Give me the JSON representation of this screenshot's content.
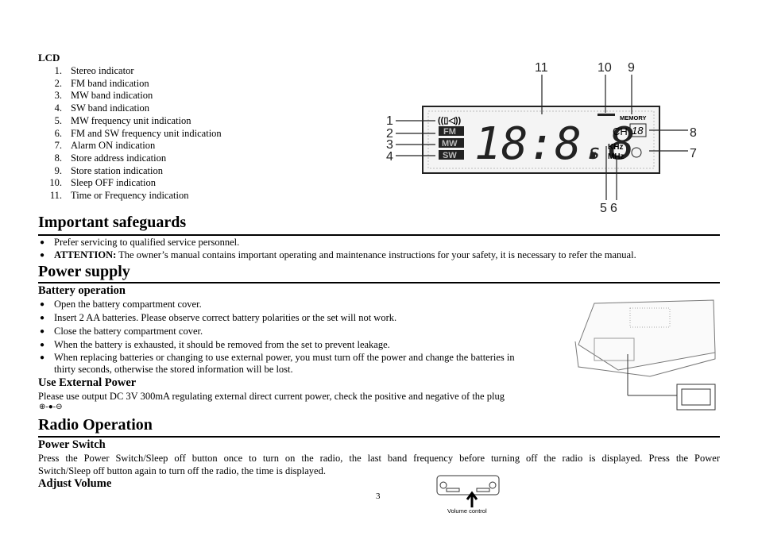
{
  "lcd": {
    "title": "LCD",
    "items": [
      "Stereo indicator",
      "FM band indication",
      "MW band indication",
      "SW band indication",
      "MW frequency unit indication",
      "FM and SW frequency unit indication",
      "Alarm ON indication",
      "Store address indication",
      "Store station indication",
      "Sleep OFF indication",
      "Time or Frequency indication"
    ],
    "diagram": {
      "callouts": [
        "1",
        "2",
        "3",
        "4",
        "5",
        "6",
        "7",
        "8",
        "9",
        "10",
        "11"
      ],
      "bands": [
        "FM",
        "MW",
        "SW"
      ],
      "digits": "18:8.8",
      "memory": "MEMORY",
      "ch": "CH",
      "ch_value": "18",
      "khz": "KHz",
      "mhz": "MHz"
    }
  },
  "safeguards": {
    "title": "Important safeguards",
    "bullets": [
      {
        "lead": "",
        "text": "Prefer servicing to qualified service personnel."
      },
      {
        "lead": "ATTENTION:",
        "text": " The owner’s manual contains important operating and maintenance instructions for your safety, it is necessary to refer the manual."
      }
    ]
  },
  "power": {
    "title": "Power supply",
    "battery_title": "Battery operation",
    "bullets": [
      "Open the battery compartment cover.",
      "Insert 2 AA batteries. Please observe correct battery polarities or the set will not work.",
      "Close the battery compartment cover.",
      "When the battery is exhausted, it should be removed from the set to prevent leakage.",
      "When replacing batteries or changing to use external power, you must turn off the power and change the batteries in",
      "thirty seconds, otherwise the stored information will be lost."
    ],
    "external_title": "Use External Power",
    "external_text": "Please use output DC 3V 300mA regulating external direct current power, check the positive and negative of the plug",
    "plug_symbol": "⊕-●-⊖"
  },
  "radio": {
    "title": "Radio Operation",
    "switch_title": "Power Switch",
    "switch_line1": "Press the Power Switch/Sleep off button once to turn on the radio, the last band frequency before turning off the radio is displayed. Press the Power",
    "switch_line2": "Switch/Sleep off button again to turn off the radio, the time is displayed.",
    "volume_title": "Adjust Volume",
    "volume_caption": "Volume control"
  },
  "page_number": "3"
}
